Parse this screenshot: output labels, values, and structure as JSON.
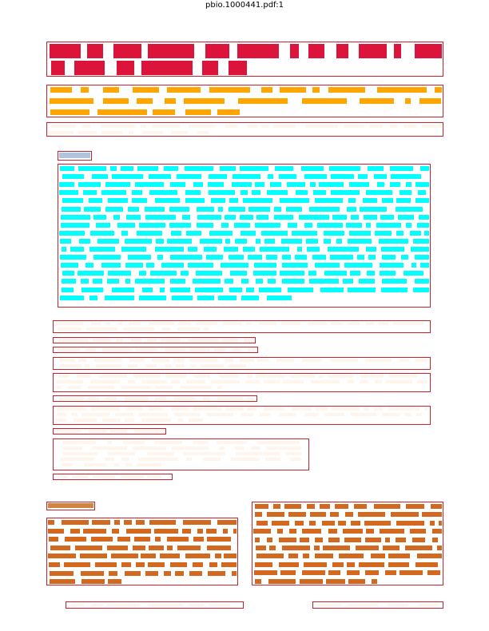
{
  "document": {
    "filename": "pbio.1000441.pdf:1"
  },
  "colors": {
    "outline": "#cc1f2c",
    "title": "#dc143c",
    "authors": "#ffa500",
    "affiliations": "#fff5ec",
    "abstract_heading": "#b0c4de",
    "abstract_text": "#00ffff",
    "body_paragraphs": "#fff5ec",
    "section_heading": "#cd853f",
    "section_text": "#d2691e",
    "footer": "#fff5ec"
  },
  "regions": [
    {
      "name": "title-block",
      "kind": "title"
    },
    {
      "name": "author-list",
      "kind": "authors"
    },
    {
      "name": "author-affiliations",
      "kind": "affiliations"
    },
    {
      "name": "abstract-heading",
      "kind": "abstract_heading"
    },
    {
      "name": "abstract-text",
      "kind": "abstract_text"
    },
    {
      "name": "citation-paragraph",
      "kind": "body_paragraphs"
    },
    {
      "name": "academic-editor-line",
      "kind": "body_paragraphs"
    },
    {
      "name": "received-date-line",
      "kind": "body_paragraphs"
    },
    {
      "name": "copyright-paragraph",
      "kind": "body_paragraphs"
    },
    {
      "name": "funding-paragraph",
      "kind": "body_paragraphs"
    },
    {
      "name": "competing-interests-line",
      "kind": "body_paragraphs"
    },
    {
      "name": "abbreviations-paragraph",
      "kind": "body_paragraphs"
    },
    {
      "name": "abbreviations-list",
      "kind": "body_paragraphs"
    },
    {
      "name": "correspondence-line",
      "kind": "body_paragraphs"
    },
    {
      "name": "section-heading",
      "kind": "section_heading"
    },
    {
      "name": "body-column-left",
      "kind": "section_text"
    },
    {
      "name": "body-column-right",
      "kind": "section_text"
    },
    {
      "name": "footer-left",
      "kind": "footer"
    },
    {
      "name": "footer-right",
      "kind": "footer"
    }
  ]
}
